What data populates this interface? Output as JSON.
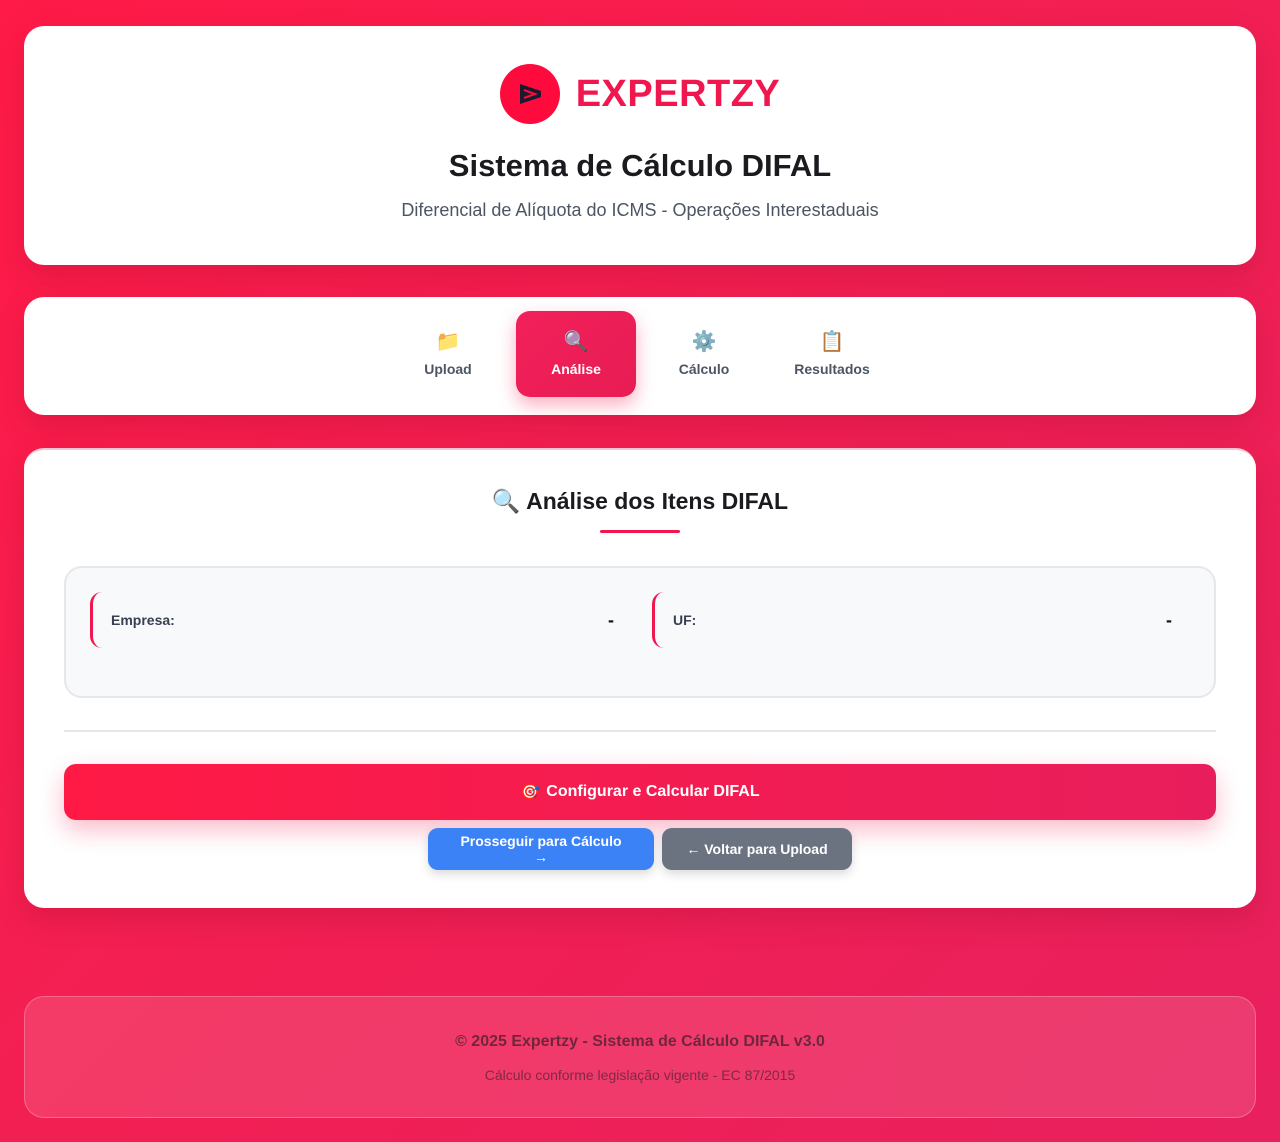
{
  "header": {
    "brand": "EXPERTZY",
    "title": "Sistema de Cálculo DIFAL",
    "subtitle": "Diferencial de Alíquota do ICMS - Operações Interestaduais"
  },
  "tabs": [
    {
      "icon": "📁",
      "icon_name": "folder-icon",
      "label": "Upload",
      "active": false
    },
    {
      "icon": "🔍",
      "icon_name": "magnifier-icon",
      "label": "Análise",
      "active": true
    },
    {
      "icon": "⚙️",
      "icon_name": "gear-icon",
      "label": "Cálculo",
      "active": false
    },
    {
      "icon": "📋",
      "icon_name": "clipboard-icon",
      "label": "Resultados",
      "active": false
    }
  ],
  "main": {
    "title_icon": "🔍",
    "title": "Análise dos Itens DIFAL",
    "fields": [
      {
        "label": "Empresa:",
        "value": "-"
      },
      {
        "label": "UF:",
        "value": "-"
      }
    ],
    "primary_button_icon": "🎯",
    "primary_button": "Configurar e Calcular DIFAL",
    "proceed_button": "Prosseguir para Cálculo →",
    "back_button": "← Voltar para Upload"
  },
  "footer": {
    "copyright": "© 2025 Expertzy - Sistema de Cálculo DIFAL v3.0",
    "note": "Cálculo conforme legislação vigente - EC 87/2015"
  },
  "colors": {
    "accent": "#f0164e",
    "proceed_button": "#3b82f6",
    "back_button": "#6b7280"
  }
}
